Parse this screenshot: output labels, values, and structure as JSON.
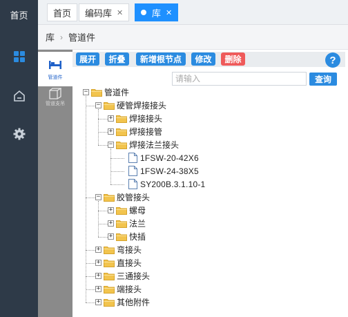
{
  "sidebar": {
    "home_label": "首页",
    "icons": [
      "grid-icon",
      "house-icon",
      "gear-icon"
    ]
  },
  "tabs": [
    {
      "label": "首页",
      "closable": false
    },
    {
      "label": "编码库",
      "closable": true
    },
    {
      "label": "库",
      "closable": true,
      "active": true
    }
  ],
  "breadcrumb": {
    "root": "库",
    "current": "管道件"
  },
  "subnav": [
    {
      "label": "管道件",
      "icon": "bed-icon",
      "active": true
    },
    {
      "label": "管道支吊",
      "icon": "cube-icon",
      "active": false
    }
  ],
  "toolbar": {
    "expand": "展开",
    "collapse": "折叠",
    "add_root": "新增根节点",
    "edit": "修改",
    "delete": "删除",
    "help": "?"
  },
  "search": {
    "placeholder": "请输入",
    "button": "查询"
  },
  "tree": [
    {
      "label": "管道件",
      "level": 0,
      "type": "folder",
      "expanded": true
    },
    {
      "label": "硬管焊接接头",
      "level": 1,
      "type": "folder",
      "expanded": true
    },
    {
      "label": "焊接接头",
      "level": 2,
      "type": "folder",
      "expanded": false
    },
    {
      "label": "焊接接管",
      "level": 2,
      "type": "folder",
      "expanded": false
    },
    {
      "label": "焊接法兰接头",
      "level": 2,
      "type": "folder",
      "expanded": true
    },
    {
      "label": "1FSW-20-42X6",
      "level": 3,
      "type": "file"
    },
    {
      "label": "1FSW-24-38X5",
      "level": 3,
      "type": "file"
    },
    {
      "label": "SY200B.3.1.10-1",
      "level": 3,
      "type": "file"
    },
    {
      "label": "胶管接头",
      "level": 1,
      "type": "folder",
      "expanded": true
    },
    {
      "label": "螺母",
      "level": 2,
      "type": "folder",
      "expanded": false
    },
    {
      "label": "法兰",
      "level": 2,
      "type": "folder",
      "expanded": false
    },
    {
      "label": "快插",
      "level": 2,
      "type": "folder",
      "expanded": false
    },
    {
      "label": "弯接头",
      "level": 1,
      "type": "folder",
      "expanded": false
    },
    {
      "label": "直接头",
      "level": 1,
      "type": "folder",
      "expanded": false
    },
    {
      "label": "三通接头",
      "level": 1,
      "type": "folder",
      "expanded": false
    },
    {
      "label": "端接头",
      "level": 1,
      "type": "folder",
      "expanded": false
    },
    {
      "label": "其他附件",
      "level": 1,
      "type": "folder",
      "expanded": false
    }
  ],
  "colors": {
    "primary": "#2b8be0",
    "danger": "#ef5a5a",
    "sidebar": "#2e3a48",
    "subnav": "#8a8a8a",
    "folder": "#f2c44e"
  }
}
